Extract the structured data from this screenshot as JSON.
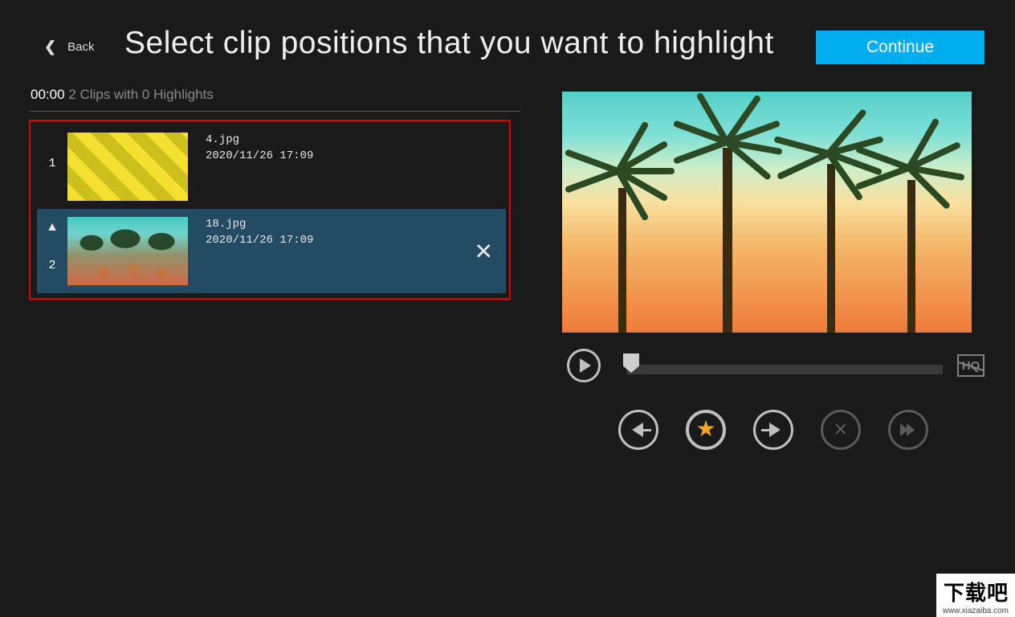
{
  "header": {
    "back_label": "Back",
    "title": "Select clip positions that you want to highlight",
    "continue_label": "Continue"
  },
  "status": {
    "time": "00:00",
    "summary": "2 Clips with 0 Highlights"
  },
  "clips": [
    {
      "index": "1",
      "filename": "4.jpg",
      "timestamp": "2020/11/26 17:09",
      "selected": false
    },
    {
      "index": "2",
      "filename": "18.jpg",
      "timestamp": "2020/11/26 17:09",
      "selected": true
    }
  ],
  "player": {
    "hq_label": "HQ"
  },
  "watermark": {
    "line1": "下载吧",
    "line2": "www.xiazaiba.com"
  }
}
